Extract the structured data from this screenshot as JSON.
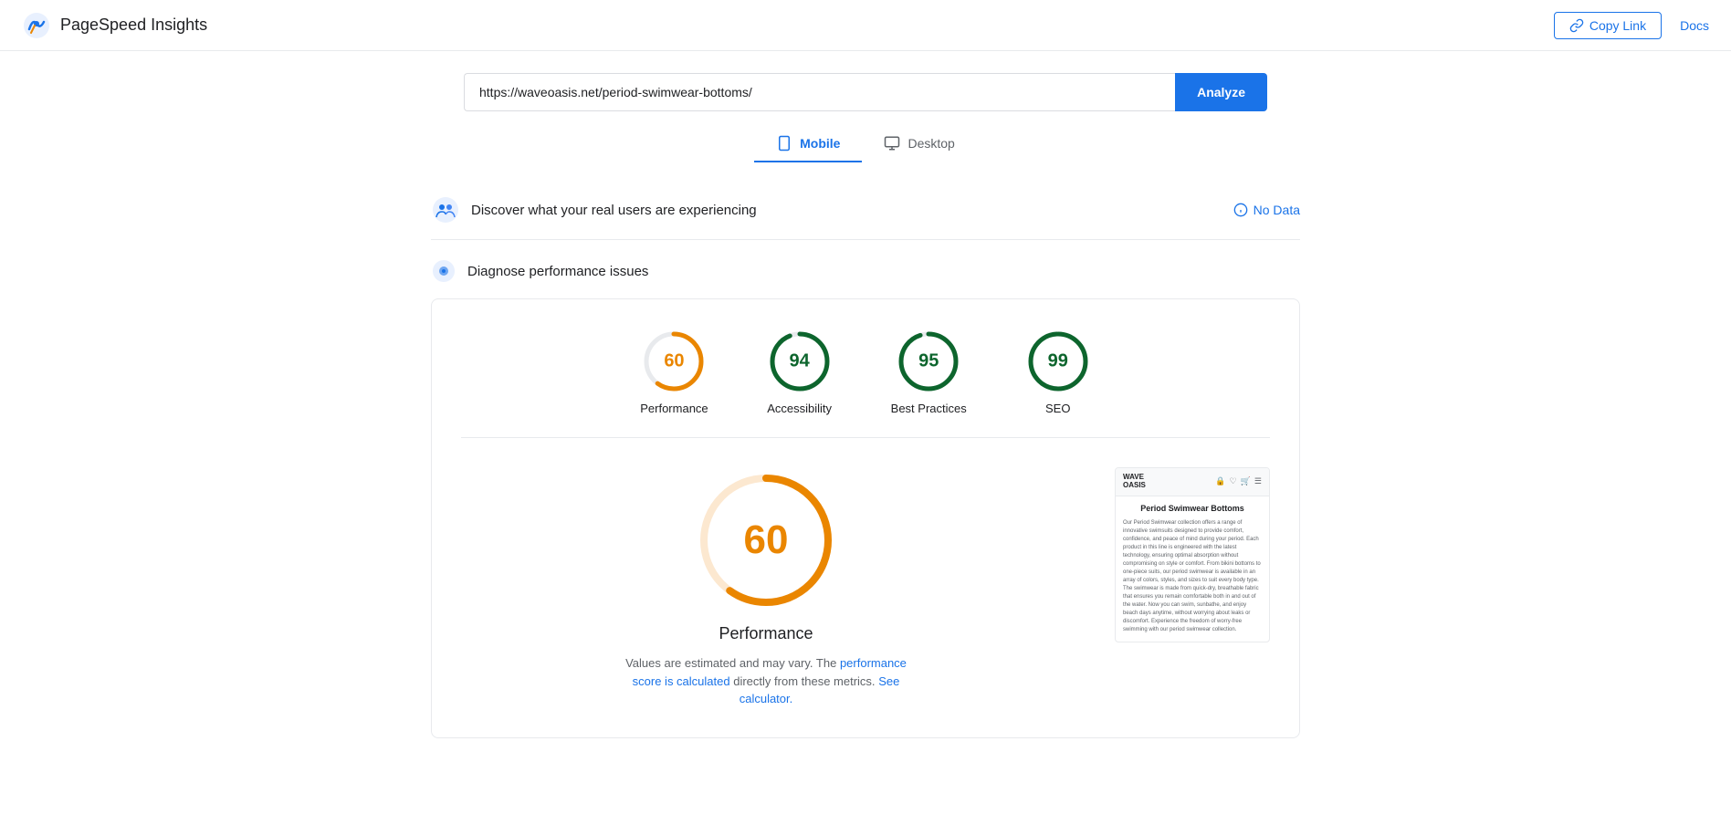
{
  "header": {
    "app_title": "PageSpeed Insights",
    "copy_link_label": "Copy Link",
    "docs_label": "Docs"
  },
  "url_bar": {
    "url_value": "https://waveoasis.net/period-swimwear-bottoms/",
    "analyze_label": "Analyze"
  },
  "tabs": [
    {
      "id": "mobile",
      "label": "Mobile",
      "active": true
    },
    {
      "id": "desktop",
      "label": "Desktop",
      "active": false
    }
  ],
  "discover": {
    "text": "Discover what your real users are experiencing",
    "no_data_label": "No Data"
  },
  "diagnose": {
    "text": "Diagnose performance issues"
  },
  "scores": [
    {
      "id": "performance",
      "value": 60,
      "label": "Performance",
      "color": "#ea8600",
      "stroke_color": "#ea8600",
      "percent": 60
    },
    {
      "id": "accessibility",
      "value": 94,
      "label": "Accessibility",
      "color": "#0d652d",
      "stroke_color": "#0d652d",
      "percent": 94
    },
    {
      "id": "best-practices",
      "value": 95,
      "label": "Best Practices",
      "color": "#0d652d",
      "stroke_color": "#0d652d",
      "percent": 95
    },
    {
      "id": "seo",
      "value": 99,
      "label": "SEO",
      "color": "#0d652d",
      "stroke_color": "#0d652d",
      "percent": 99
    }
  ],
  "large_score": {
    "value": 60,
    "title": "Performance",
    "note1": "Values are estimated and may vary. The",
    "note2": "performance score is calculated",
    "note3": "directly from these metrics.",
    "note4": "See calculator."
  },
  "preview": {
    "logo_line1": "WAVE",
    "logo_line2": "OASIS",
    "page_title": "Period Swimwear Bottoms",
    "body_text": "Our Period Swimwear collection offers a range of innovative swimsuits designed to provide comfort, confidence, and peace of mind during your period. Each product in this line is engineered with the latest technology, ensuring optimal absorption without compromising on style or comfort. From bikini bottoms to one-piece suits, our period swimwear is available in an array of colors, styles, and sizes to suit every body type. The swimwear is made from quick-dry, breathable fabric that ensures you remain comfortable both in and out of the water. Now you can swim, sunbathe, and enjoy beach days anytime, without worrying about leaks or discomfort. Experience the freedom of worry-free swimming with our period swimwear collection."
  }
}
